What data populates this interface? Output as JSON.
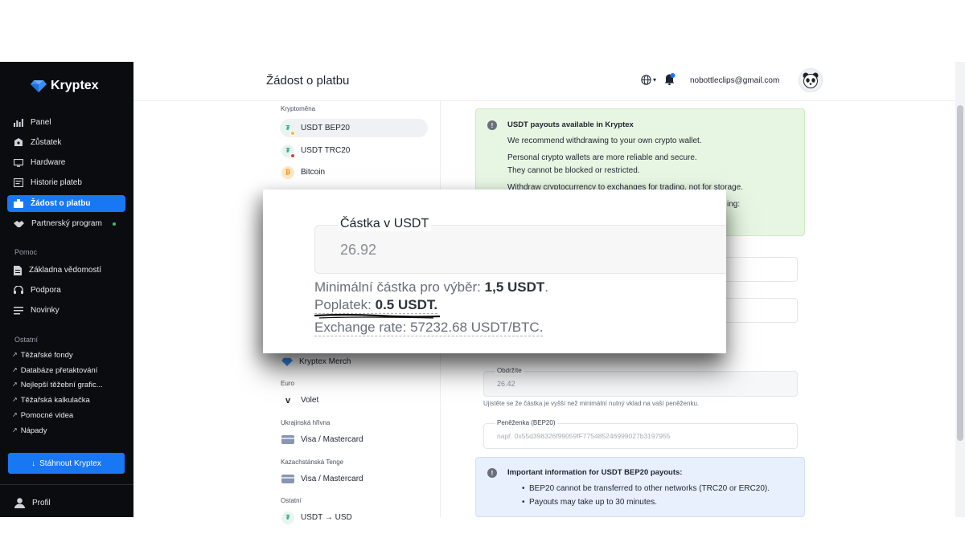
{
  "sidebar": {
    "brand": "Kryptex",
    "nav": [
      {
        "label": "Panel",
        "icon": "chart-bars-icon"
      },
      {
        "label": "Zůstatek",
        "icon": "wallet-icon"
      },
      {
        "label": "Hardware",
        "icon": "monitor-icon"
      },
      {
        "label": "Historie plateb",
        "icon": "history-icon"
      },
      {
        "label": "Žádost o platbu",
        "icon": "payout-icon",
        "active": true
      },
      {
        "label": "Partnerský program",
        "icon": "handshake-icon"
      }
    ],
    "help_label": "Pomoc",
    "help": [
      {
        "label": "Základna vědomostí",
        "icon": "document-icon"
      },
      {
        "label": "Podpora",
        "icon": "headset-icon"
      },
      {
        "label": "Novinky",
        "icon": "list-icon"
      }
    ],
    "other_label": "Ostatní",
    "other": [
      {
        "label": "Těžařské fondy"
      },
      {
        "label": "Databáze přetaktování"
      },
      {
        "label": "Nejlepší těžební grafic..."
      },
      {
        "label": "Těžařská kalkulačka"
      },
      {
        "label": "Pomocné videa"
      },
      {
        "label": "Nápady"
      }
    ],
    "download_label": "Stáhnout Kryptex",
    "profile_label": "Profil"
  },
  "header": {
    "title": "Žádost o platbu",
    "email": "nobottleclips@gmail.com",
    "notification_count": "1"
  },
  "methods": {
    "crypto_label": "Kryptoměna",
    "crypto": [
      {
        "label": "USDT BEP20",
        "active": true,
        "badge_color": "#f3ba2f"
      },
      {
        "label": "USDT TRC20",
        "badge_color": "#e53935"
      },
      {
        "label": "Bitcoin"
      }
    ],
    "merch_label": "Kryptex Merch",
    "euro_label": "Euro",
    "euro_item": "Volet",
    "uah_label": "Ukrajinská hřivna",
    "uah_item": "Visa / Mastercard",
    "kzt_label": "Kazachstánská Tenge",
    "kzt_item": "Visa / Mastercard",
    "other_label": "Ostatní",
    "other_item": "USDT → USD"
  },
  "info_green": {
    "title": "USDT payouts available in Kryptex",
    "lines": [
      "We recommend withdrawing to your own crypto wallet.",
      "Personal crypto wallets are more reliable and secure.",
      "They cannot be blocked or restricted.",
      "Withdraw cryptocurrency to exchanges for trading, not for storage.",
      "ing:"
    ]
  },
  "form": {
    "receive_label": "Obdržíte",
    "receive_value": "26.42",
    "hint": "Ujistěte se že částka je vyšší než minimální nutný vklad na vaší peněženku.",
    "wallet_label": "Peněženka (BEP20)",
    "wallet_placeholder": "např. 0x55d398326f99059fF775485246999027b3197955"
  },
  "info_blue": {
    "title": "Important information for USDT BEP20 payouts:",
    "bullets": [
      "BEP20 cannot be transferred to other networks (TRC20 or ERC20).",
      "Payouts may take up to 30 minutes."
    ]
  },
  "zoom": {
    "amount_label": "Částka v USDT",
    "amount_value": "26.92",
    "min_prefix": "Minimální částka pro výběr: ",
    "min_value": "1,5 USDT",
    "min_suffix": ".",
    "fee_prefix": "Poplatek: ",
    "fee_value": "0.5 USDT.",
    "rate": "Exchange rate: 57232.68 USDT/BTC."
  },
  "colors": {
    "accent": "#1877f2",
    "sidebar_bg": "#0b0c10",
    "success_bg": "#e7f6e2",
    "info_bg": "#e8f0fd"
  }
}
